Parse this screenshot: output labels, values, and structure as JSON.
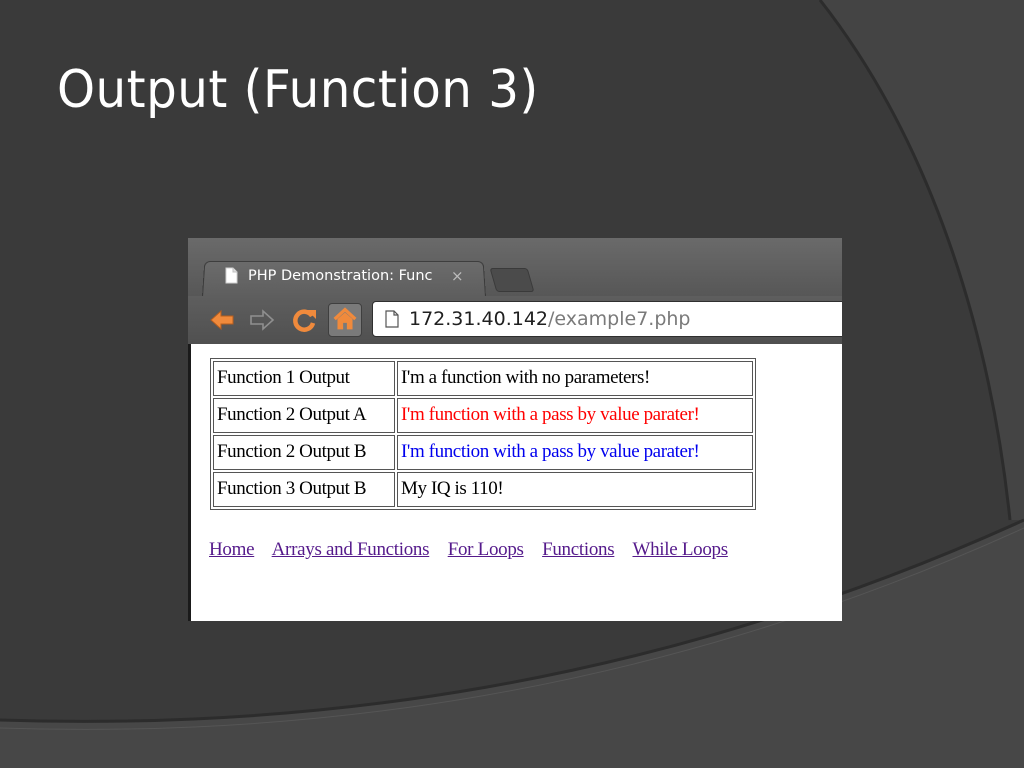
{
  "slide": {
    "title": "Output (Function 3)"
  },
  "browser": {
    "tab_title": "PHP Demonstration: Func",
    "tab_close": "×",
    "url_host": "172.31.40.142",
    "url_path": "/example7.php",
    "icons": {
      "tab": "document-icon",
      "back": "arrow-left-icon",
      "forward": "arrow-right-icon",
      "reload": "reload-icon",
      "home": "home-icon",
      "page": "document-icon"
    }
  },
  "page": {
    "rows": [
      {
        "label": "Function 1 Output",
        "value": "I'm a function with no parameters!",
        "color": "#000000"
      },
      {
        "label": "Function 2 Output A",
        "value": "I'm function with a pass by value parater!",
        "color": "#ff0000"
      },
      {
        "label": "Function 2 Output B",
        "value": "I'm function with a pass by value parater!",
        "color": "#0000ee"
      },
      {
        "label": "Function 3 Output B",
        "value": "My IQ is 110!",
        "color": "#000000"
      }
    ],
    "links": [
      "Home",
      "Arrays and Functions",
      "For Loops",
      "Functions",
      "While Loops"
    ]
  },
  "colors": {
    "slide_bg": "#3a3a3a",
    "link": "#551a8b"
  }
}
